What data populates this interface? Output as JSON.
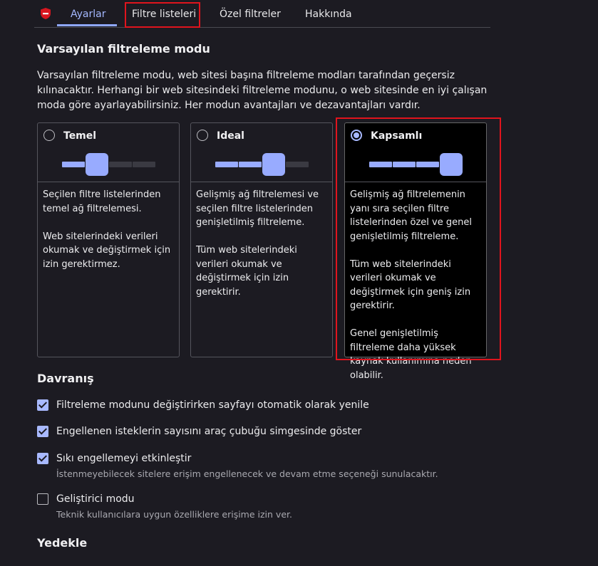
{
  "tabs": [
    {
      "label": "Ayarlar",
      "active": true
    },
    {
      "label": "Filtre listeleri",
      "active": false
    },
    {
      "label": "Özel filtreler",
      "active": false
    },
    {
      "label": "Hakkında",
      "active": false
    }
  ],
  "colors": {
    "accent": "#8fa8ff",
    "highlight": "#e0141d",
    "background": "#1c1b22"
  },
  "icons": {
    "logo": "shield-icon"
  },
  "filter_mode": {
    "heading": "Varsayılan filtreleme modu",
    "description": "Varsayılan filtreleme modu, web sitesi başına filtreleme modları tarafından geçersiz kılınacaktır. Herhangi bir web sitesindeki filtreleme modunu, o web sitesinde en iyi çalışan moda göre ayarlayabilirsiniz. Her modun avantajları ve dezavantajları vardır.",
    "modes": [
      {
        "title": "Temel",
        "selected": false,
        "level": 1,
        "paragraphs": [
          "Seçilen filtre listelerinden temel ağ filtrelemesi.",
          "Web sitelerindeki verileri okumak ve değiştirmek için izin gerektirmez."
        ]
      },
      {
        "title": "Ideal",
        "selected": false,
        "level": 2,
        "paragraphs": [
          "Gelişmiş ağ filtrelemesi ve seçilen filtre listelerinden genişletilmiş filtreleme.",
          "Tüm web sitelerindeki verileri okumak ve değiştirmek için izin gerektirir."
        ]
      },
      {
        "title": "Kapsamlı",
        "selected": true,
        "level": 3,
        "paragraphs": [
          "Gelişmiş ağ filtrelemenin yanı sıra seçilen filtre listelerinden özel ve genel genişletilmiş filtreleme.",
          "Tüm web sitelerindeki verileri okumak ve değiştirmek için geniş izin gerektirir.",
          "Genel genişletilmiş filtreleme daha yüksek kaynak kullanımına neden olabilir."
        ]
      }
    ]
  },
  "behavior": {
    "heading": "Davranış",
    "options": [
      {
        "label": "Filtreleme modunu değiştirirken sayfayı otomatik olarak yenile",
        "checked": true,
        "sub": ""
      },
      {
        "label": "Engellenen isteklerin sayısını araç çubuğu simgesinde göster",
        "checked": true,
        "sub": ""
      },
      {
        "label": "Sıkı engellemeyi etkinleştir",
        "checked": true,
        "sub": "İstenmeyebilecek sitelere erişim engellenecek ve devam etme seçeneği sunulacaktır."
      },
      {
        "label": "Geliştirici modu",
        "checked": false,
        "sub": "Teknik kullanıcılara uygun özelliklere erişime izin ver."
      }
    ]
  },
  "backup": {
    "heading": "Yedekle"
  }
}
